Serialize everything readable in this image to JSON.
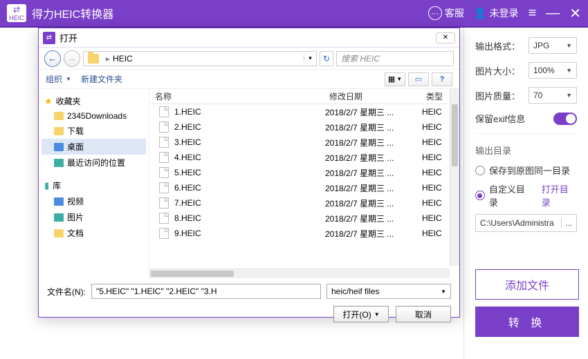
{
  "app": {
    "title": "得力HEIC转换器",
    "logo_text": "HEIC",
    "customer_service": "客服",
    "login_status": "未登录"
  },
  "settings": {
    "format_label": "输出格式：",
    "format_value": "JPG",
    "size_label": "图片大小：",
    "size_value": "100%",
    "quality_label": "图片质量：",
    "quality_value": "70",
    "exif_label": "保留exif信息",
    "output_dir_title": "输出目录",
    "radio_same": "保存到原图同一目录",
    "radio_custom": "自定义目录",
    "open_dir": "打开目录",
    "path_value": "C:\\Users\\Administra",
    "add_files": "添加文件",
    "convert": "转 换"
  },
  "dialog": {
    "title": "打开",
    "breadcrumb": "HEIC",
    "search_placeholder": "搜索 HEIC",
    "organize": "组织",
    "new_folder": "新建文件夹",
    "tree": {
      "favorites": "收藏夹",
      "fav_items": [
        "2345Downloads",
        "下载",
        "桌面",
        "最近访问的位置"
      ],
      "library": "库",
      "lib_items": [
        "视频",
        "图片",
        "文档"
      ]
    },
    "columns": {
      "name": "名称",
      "date": "修改日期",
      "type": "类型"
    },
    "files": [
      {
        "name": "1.HEIC",
        "date": "2018/2/7 星期三 ...",
        "type": "HEIC"
      },
      {
        "name": "2.HEIC",
        "date": "2018/2/7 星期三 ...",
        "type": "HEIC"
      },
      {
        "name": "3.HEIC",
        "date": "2018/2/7 星期三 ...",
        "type": "HEIC"
      },
      {
        "name": "4.HEIC",
        "date": "2018/2/7 星期三 ...",
        "type": "HEIC"
      },
      {
        "name": "5.HEIC",
        "date": "2018/2/7 星期三 ...",
        "type": "HEIC"
      },
      {
        "name": "6.HEIC",
        "date": "2018/2/7 星期三 ...",
        "type": "HEIC"
      },
      {
        "name": "7.HEIC",
        "date": "2018/2/7 星期三 ...",
        "type": "HEIC"
      },
      {
        "name": "8.HEIC",
        "date": "2018/2/7 星期三 ...",
        "type": "HEIC"
      },
      {
        "name": "9.HEIC",
        "date": "2018/2/7 星期三 ...",
        "type": "HEIC"
      }
    ],
    "filename_label": "文件名(N):",
    "filename_value": "\"5.HEIC\" \"1.HEIC\" \"2.HEIC\" \"3.H",
    "filter_value": "heic/heif files",
    "open_btn": "打开(O)",
    "cancel_btn": "取消"
  }
}
